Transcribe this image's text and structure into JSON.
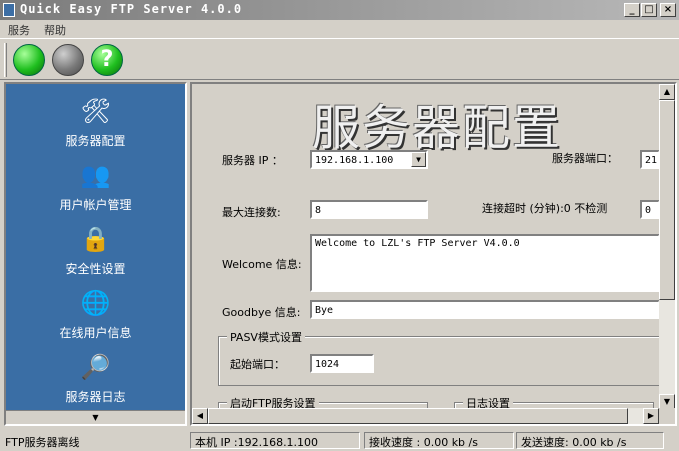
{
  "window": {
    "title": "Quick Easy FTP Server 4.0.0",
    "minimize": "_",
    "maximize": "□",
    "close": "×"
  },
  "menu": {
    "items": [
      "服务",
      "帮助"
    ]
  },
  "toolbar": {
    "start_icon": "green-circle-icon",
    "stop_icon": "gray-circle-icon",
    "help_icon": "help-icon",
    "help_glyph": "?"
  },
  "nav": {
    "items": [
      {
        "label": "服务器配置",
        "icon": "tools-icon",
        "glyph": "🛠"
      },
      {
        "label": "用户帐户管理",
        "icon": "users-icon",
        "glyph": "👥"
      },
      {
        "label": "安全性设置",
        "icon": "lock-icon",
        "glyph": "🔒"
      },
      {
        "label": "在线用户信息",
        "icon": "globe-user-icon",
        "glyph": "🌐"
      },
      {
        "label": "服务器日志",
        "icon": "log-icon",
        "glyph": "🔎"
      }
    ],
    "scroll_down": "▼"
  },
  "config": {
    "heading": "服务器配置",
    "server_ip_label": "服务器 IP ：",
    "server_ip_value": "192.168.1.100",
    "server_port_label": "服务器端口：",
    "server_port_value": "21",
    "max_conn_label": "最大连接数:",
    "max_conn_value": "8",
    "timeout_label": "连接超时 (分钟):0 不检测",
    "timeout_value": "0",
    "welcome_label": "Welcome 信息:",
    "welcome_value": "Welcome to LZL's FTP Server V4.0.0",
    "goodbye_label": "Goodbye 信息:",
    "goodbye_value": "Bye",
    "pasv_group": "PASV模式设置",
    "start_port_label": "起始端口：",
    "start_port_value": "1024",
    "ftp_group": "启动FTP服务设置",
    "log_group": "日志设置"
  },
  "scroll": {
    "up": "▲",
    "down": "▼",
    "left": "◀",
    "right": "▶"
  },
  "status": {
    "server_state": "FTP服务器离线",
    "local_ip": "本机 IP :192.168.1.100",
    "recv_speed": "接收速度 : 0.00   kb /s",
    "send_speed": "发送速度:  0.00   kb /s"
  }
}
